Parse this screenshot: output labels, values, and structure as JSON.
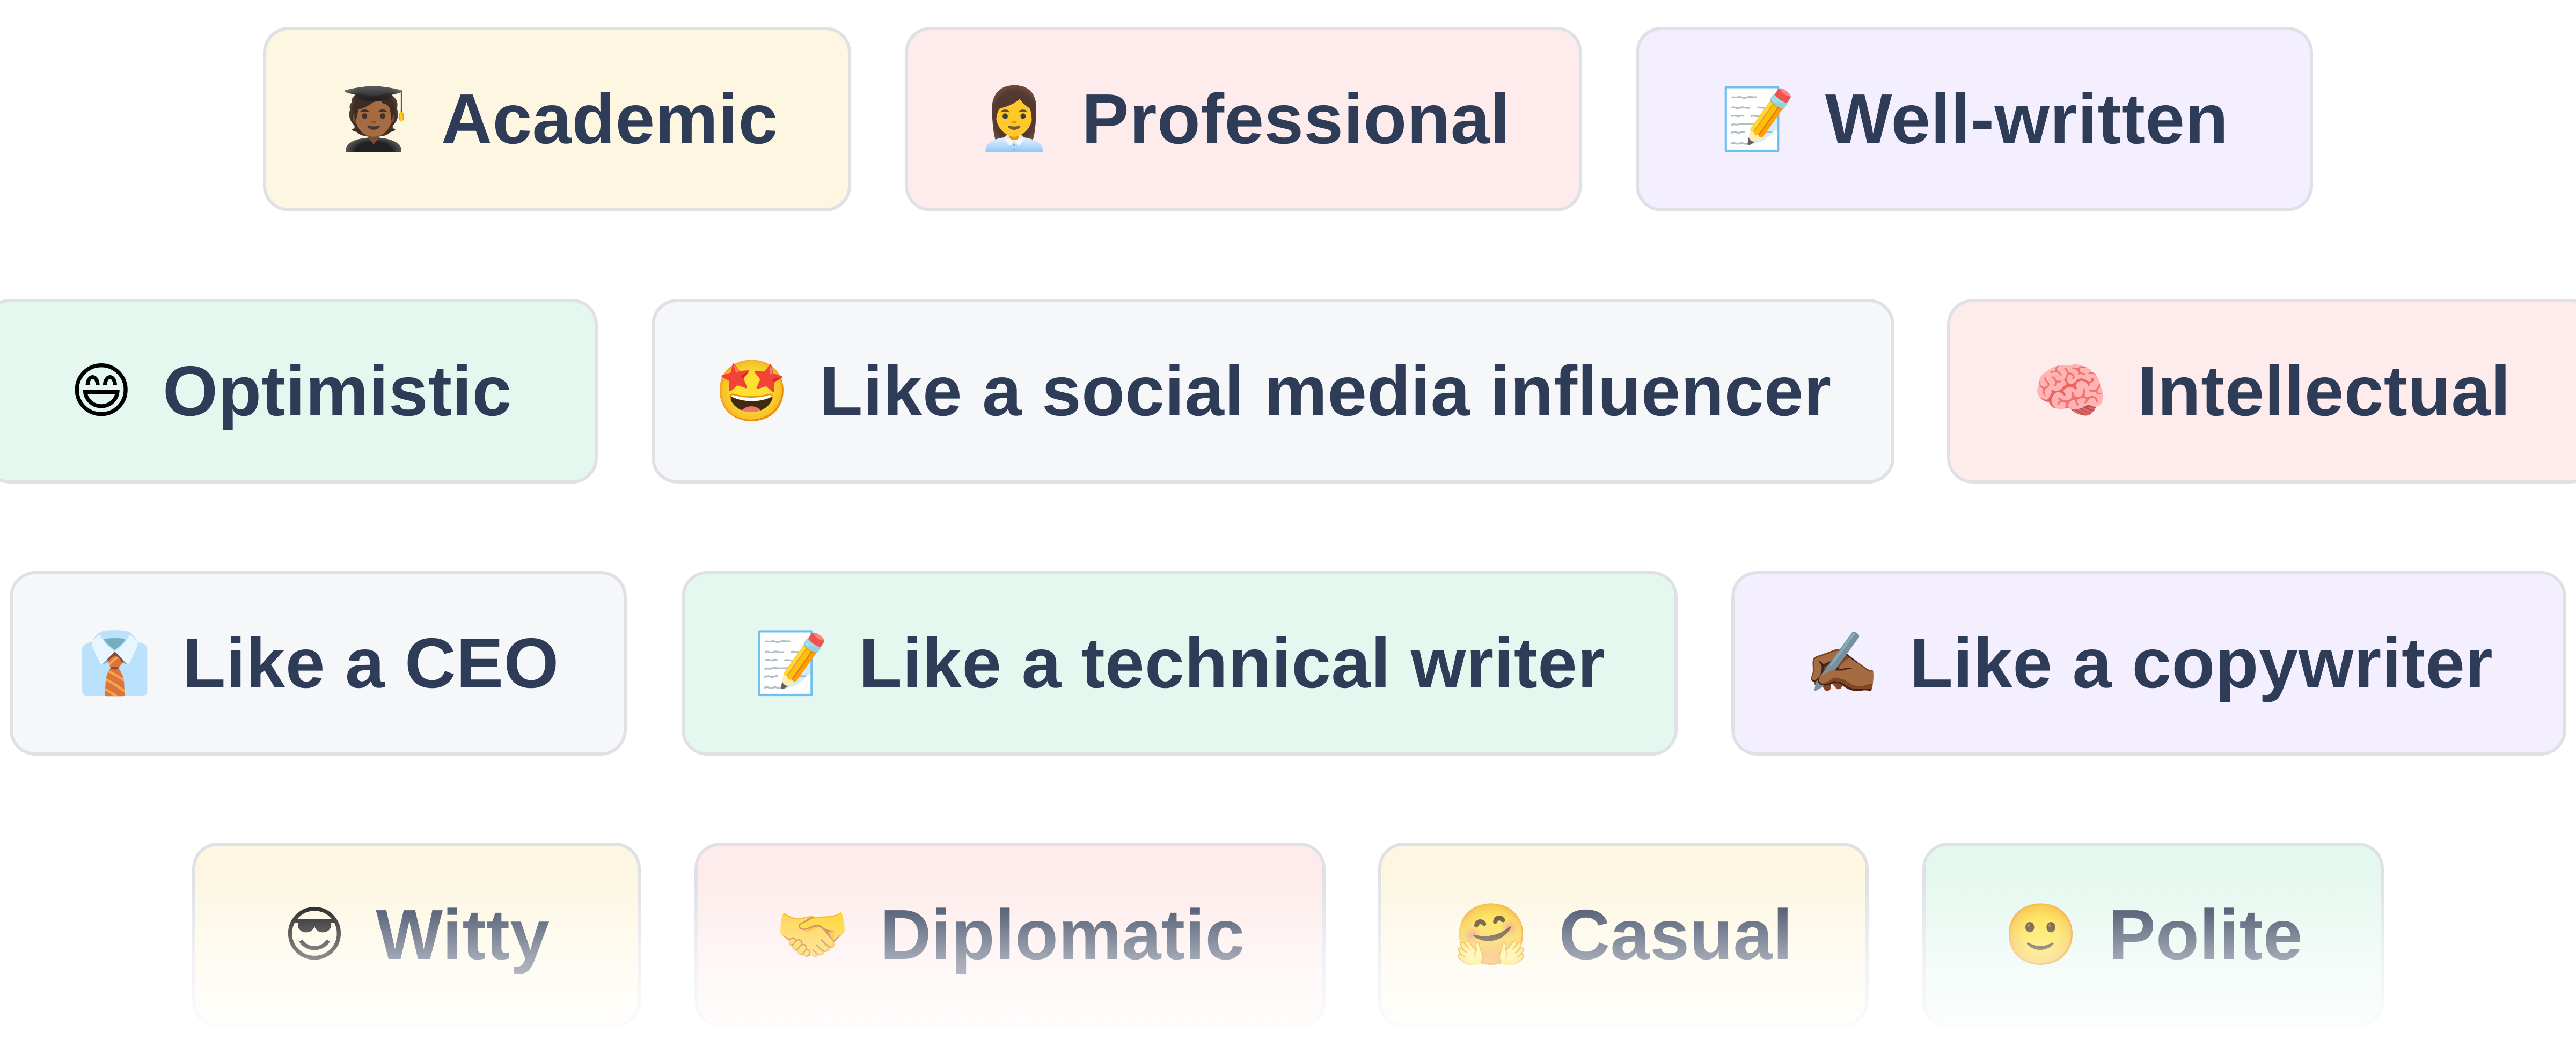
{
  "tone_options": [
    {
      "emoji": "🧑🏾‍🎓",
      "icon": "graduate-icon",
      "label": "Academic",
      "color": "#fdf7e2"
    },
    {
      "emoji": "👩‍💼",
      "icon": "office-worker-icon",
      "label": "Professional",
      "color": "#fdeceb"
    },
    {
      "emoji": "📝",
      "icon": "memo-icon",
      "label": "Well-written",
      "color": "#f3efff"
    },
    {
      "emoji": "😄",
      "icon": "grinning-face-icon",
      "label": "Optimistic",
      "color": "#e5f8ef"
    },
    {
      "emoji": "🤩",
      "icon": "star-struck-icon",
      "label": "Like a social media influencer",
      "color": "#f6f7f9"
    },
    {
      "emoji": "🧠",
      "icon": "brain-icon",
      "label": "Intellectual",
      "color": "#fdeceb"
    },
    {
      "emoji": "👔",
      "icon": "necktie-icon",
      "label": "Like a CEO",
      "color": "#f6f7f9"
    },
    {
      "emoji": "📝",
      "icon": "memo-icon",
      "label": "Like a technical writer",
      "color": "#e5f8ef"
    },
    {
      "emoji": "✍🏾",
      "icon": "writing-hand-icon",
      "label": "Like a copywriter",
      "color": "#f3efff"
    },
    {
      "emoji": "😎",
      "icon": "sunglasses-face-icon",
      "label": "Witty",
      "color": "#fdf7e2"
    },
    {
      "emoji": "🤝",
      "icon": "handshake-icon",
      "label": "Diplomatic",
      "color": "#fdeceb"
    },
    {
      "emoji": "🤗",
      "icon": "hugging-face-icon",
      "label": "Casual",
      "color": "#fdf7e2"
    },
    {
      "emoji": "🙂",
      "icon": "slightly-smiling-face-icon",
      "label": "Polite",
      "color": "#e5f8ef"
    }
  ],
  "colors": {
    "label_text": "#2f3c58",
    "chip_border": "#dfe1e7"
  }
}
